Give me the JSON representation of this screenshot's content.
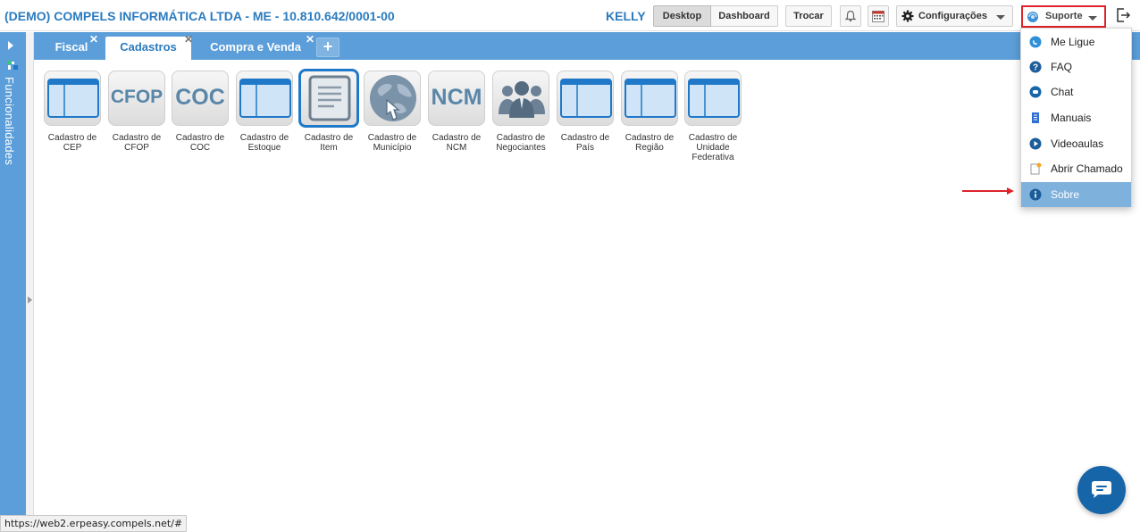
{
  "header": {
    "company_title": "(DEMO) COMPELS INFORMÁTICA LTDA - ME - 10.810.642/0001-00",
    "username": "KELLY",
    "desktop_label": "Desktop",
    "dashboard_label": "Dashboard",
    "trocar_label": "Trocar",
    "config_label": "Configurações",
    "suporte_label": "Suporte"
  },
  "sidebar": {
    "label": "Funcionalidades"
  },
  "tabs": [
    {
      "label": "Fiscal",
      "active": false
    },
    {
      "label": "Cadastros",
      "active": true
    },
    {
      "label": "Compra e Venda",
      "active": false
    }
  ],
  "tiles": [
    {
      "label": "Cadastro de CEP",
      "icon": "window-icon"
    },
    {
      "label": "Cadastro de CFOP",
      "icon": "text-icon",
      "icon_text": "CFOP"
    },
    {
      "label": "Cadastro de COC",
      "icon": "text-icon",
      "icon_text": "COC"
    },
    {
      "label": "Cadastro de Estoque",
      "icon": "window-icon"
    },
    {
      "label": "Cadastro de Item",
      "icon": "document-icon",
      "selected": true
    },
    {
      "label": "Cadastro de Município",
      "icon": "globe-icon"
    },
    {
      "label": "Cadastro de NCM",
      "icon": "text-icon",
      "icon_text": "NCM"
    },
    {
      "label": "Cadastro de Negociantes",
      "icon": "people-icon"
    },
    {
      "label": "Cadastro de País",
      "icon": "window-icon"
    },
    {
      "label": "Cadastro de Região",
      "icon": "window-icon"
    },
    {
      "label": "Cadastro de Unidade Federativa",
      "icon": "window-icon"
    }
  ],
  "support_menu": {
    "items": [
      {
        "label": "Me Ligue",
        "icon": "phone-icon"
      },
      {
        "label": "FAQ",
        "icon": "question-icon"
      },
      {
        "label": "Chat",
        "icon": "chat-icon"
      },
      {
        "label": "Manuais",
        "icon": "manual-icon"
      },
      {
        "label": "Videoaulas",
        "icon": "play-icon"
      },
      {
        "label": "Abrir Chamado",
        "icon": "ticket-icon"
      },
      {
        "label": "Sobre",
        "icon": "info-icon",
        "hover": true
      }
    ]
  },
  "status_url": "https://web2.erpeasy.compels.net/#",
  "colors": {
    "accent": "#5b9ed9",
    "title": "#2b7bbf",
    "highlight_border": "#e0232b",
    "hover": "#7fb1dd"
  }
}
